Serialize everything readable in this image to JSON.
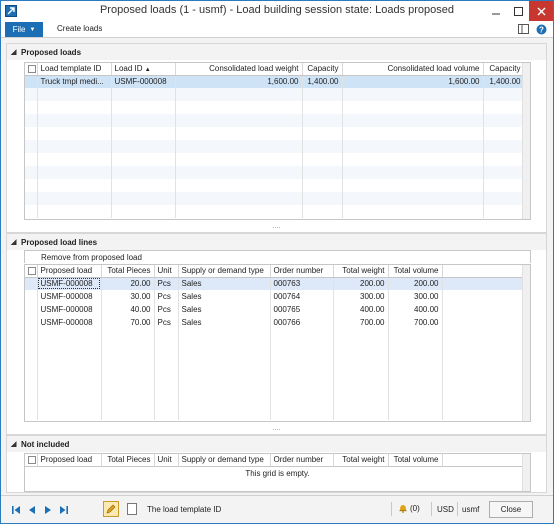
{
  "window": {
    "title": "Proposed loads (1 - usmf) - Load building session state: Loads proposed"
  },
  "ribbon": {
    "file_label": "File",
    "create_loads_label": "Create loads"
  },
  "proposed_loads": {
    "title": "Proposed loads",
    "columns": [
      "Load template ID",
      "Load ID",
      "Consolidated load weight",
      "Capacity",
      "Consolidated load volume",
      "Capacity"
    ],
    "sort_indicator": "▲",
    "rows": [
      [
        "Truck tmpl medi...",
        "USMF-000008",
        "1,600.00",
        "1,400.00",
        "1,600.00",
        "1,400.00"
      ]
    ]
  },
  "proposed_load_lines": {
    "title": "Proposed load lines",
    "action": "Remove from proposed load",
    "columns": [
      "Proposed load",
      "Total Pieces",
      "Unit",
      "Supply or demand type",
      "Order number",
      "Total weight",
      "Total volume"
    ],
    "rows": [
      [
        "USMF-000008",
        "20.00",
        "Pcs",
        "Sales",
        "000763",
        "200.00",
        "200.00"
      ],
      [
        "USMF-000008",
        "30.00",
        "Pcs",
        "Sales",
        "000764",
        "300.00",
        "300.00"
      ],
      [
        "USMF-000008",
        "40.00",
        "Pcs",
        "Sales",
        "000765",
        "400.00",
        "400.00"
      ],
      [
        "USMF-000008",
        "70.00",
        "Pcs",
        "Sales",
        "000766",
        "700.00",
        "700.00"
      ]
    ]
  },
  "not_included": {
    "title": "Not included",
    "columns": [
      "Proposed load",
      "Total Pieces",
      "Unit",
      "Supply or demand type",
      "Order number",
      "Total weight",
      "Total volume"
    ],
    "empty_message": "This grid is empty."
  },
  "statusbar": {
    "help_text": "The load template ID",
    "notifications": "(0)",
    "currency": "USD",
    "company": "usmf",
    "close_label": "Close"
  },
  "gripper": "....",
  "colors": {
    "accent": "#1c6fb5",
    "selection": "#cfe3f7",
    "close": "#c7372f"
  }
}
